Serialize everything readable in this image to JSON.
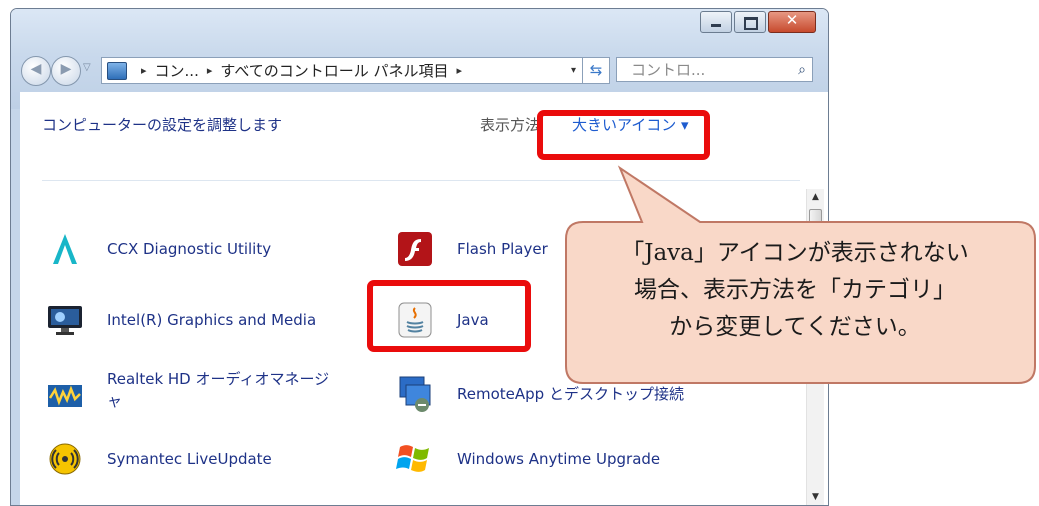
{
  "window": {
    "caption_buttons": [
      "minimize",
      "maximize",
      "close"
    ],
    "close_glyph": "✕"
  },
  "nav": {
    "back_glyph": "◀",
    "forward_glyph": "▶",
    "history_glyph": "▽",
    "breadcrumb": [
      "コン...",
      "すべてのコントロール パネル項目"
    ],
    "sep": "▸",
    "dropdown_glyph": "▾",
    "refresh_glyph": "⇆",
    "search_placeholder": "コントロ...",
    "search_glyph": "⌕"
  },
  "header": {
    "title": "コンピューターの設定を調整します",
    "view_by_label": "表示方法",
    "view_by_value": "大きいアイコン ▾"
  },
  "items": [
    {
      "label": "CCX Diagnostic Utility",
      "icon": "ccx-icon"
    },
    {
      "label": "Flash Player",
      "icon": "flash-icon"
    },
    {
      "label": "Intel(R) Graphics and Media",
      "icon": "intel-graphics-icon"
    },
    {
      "label": "Java",
      "icon": "java-icon"
    },
    {
      "label": "Realtek HD オーディオマネージ",
      "label2": "ャ",
      "icon": "realtek-icon"
    },
    {
      "label": "RemoteApp とデスクトップ接続",
      "icon": "remoteapp-icon"
    },
    {
      "label": "Symantec LiveUpdate",
      "icon": "symantec-icon"
    },
    {
      "label": "Windows Anytime Upgrade",
      "icon": "windows-flag-icon"
    }
  ],
  "callout": {
    "line1": "「Java」アイコンが表示されない",
    "line2": "場合、表示方法を「カテゴリ」",
    "line3": "から変更してください。"
  },
  "colors": {
    "highlight": "#ea0c0c",
    "link": "#1e3287",
    "callout_fill": "#f9d8c8",
    "callout_stroke": "#c07865"
  }
}
